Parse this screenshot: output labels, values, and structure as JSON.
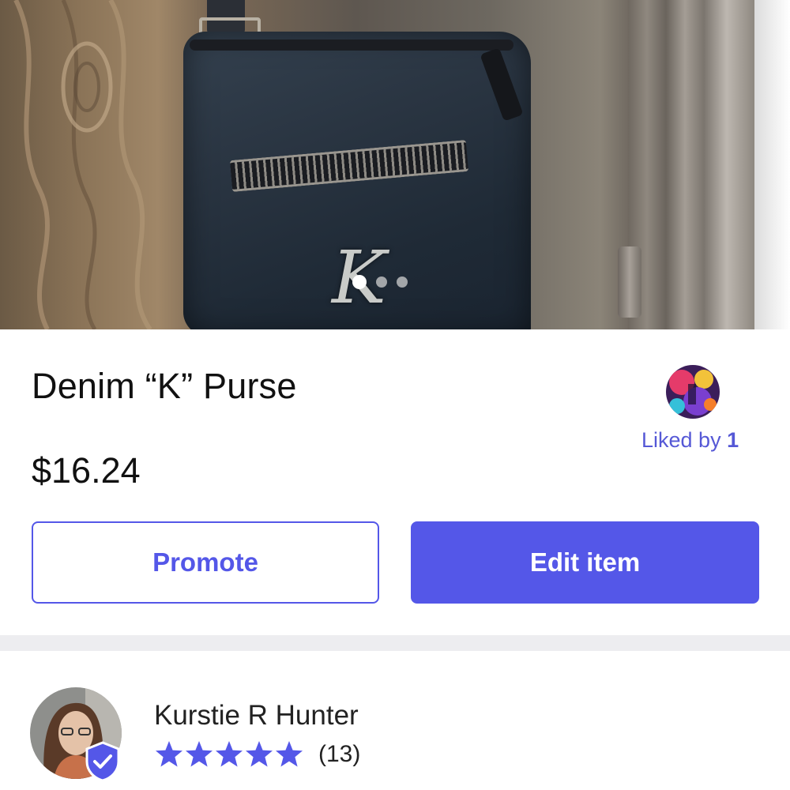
{
  "listing": {
    "title": "Denim “K” Purse",
    "price": "$16.24",
    "photo_count": 3,
    "active_photo_index": 0,
    "monogram_letter": "K"
  },
  "likes": {
    "label_prefix": "Liked by ",
    "count": "1"
  },
  "actions": {
    "promote_label": "Promote",
    "edit_label": "Edit item"
  },
  "seller": {
    "name": "Kurstie R Hunter",
    "rating": 5,
    "review_count": "(13)",
    "verified": true
  },
  "colors": {
    "accent": "#5457e8",
    "link": "#5558d6",
    "divider": "#ededf0"
  },
  "icons": {
    "rating_star": "star-icon",
    "verified": "verified-shield-icon"
  }
}
